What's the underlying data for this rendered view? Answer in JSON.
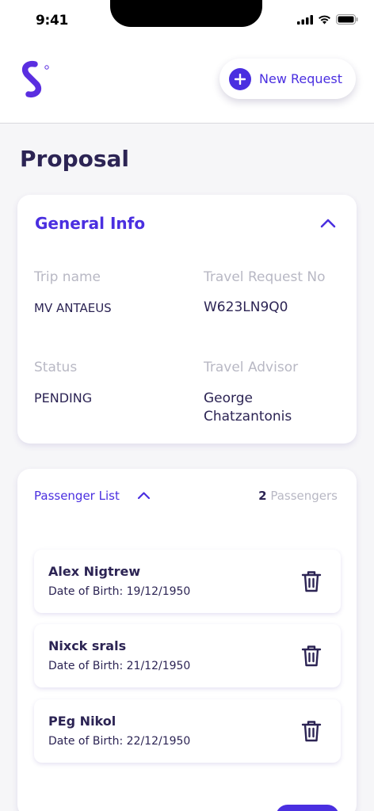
{
  "status_bar": {
    "time": "9:41"
  },
  "header": {
    "new_request_label": "New Request",
    "accent": "#4a2fe0"
  },
  "page": {
    "title": "Proposal"
  },
  "general_info": {
    "heading": "General Info",
    "trip_name_label": "Trip name",
    "trip_name_value": "MV ANTAEUS",
    "travel_request_no_label": "Travel Request No",
    "travel_request_no_value": "W623LN9Q0",
    "status_label": "Status",
    "status_value": "PENDING",
    "travel_advisor_label": "Travel Advisor",
    "travel_advisor_value_line1": "George",
    "travel_advisor_value_line2": "Chatzantonis"
  },
  "passenger_list": {
    "label": "Passenger List",
    "count": "2",
    "count_suffix": "Passengers",
    "passengers": [
      {
        "name": "Alex Nigtrew",
        "dob": "Date of Birth: 19/12/1950"
      },
      {
        "name": "Nixck srals",
        "dob": "Date of Birth: 21/12/1950"
      },
      {
        "name": "PEg Nikol",
        "dob": "Date of Birth: 22/12/1950"
      }
    ]
  },
  "icons": [
    "logo-icon",
    "plus-icon",
    "chevron-up-icon",
    "trash-icon",
    "signal-icon",
    "wifi-icon",
    "battery-icon"
  ]
}
